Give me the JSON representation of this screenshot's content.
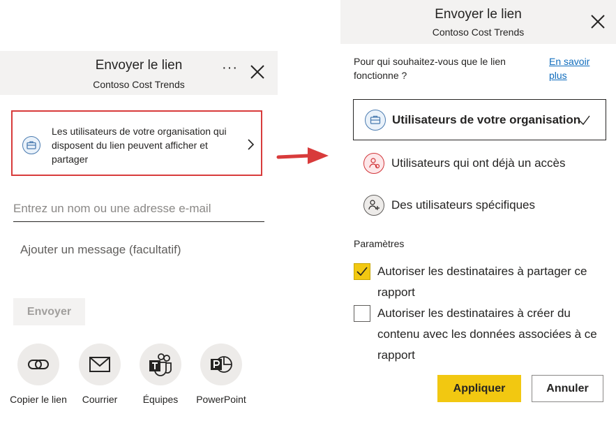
{
  "left_panel": {
    "title": "Envoyer le lien",
    "subtitle": "Contoso Cost Trends",
    "more_label": "···",
    "link_setting_text": "Les utilisateurs de votre organisation qui disposent du lien peuvent afficher et partager",
    "email_placeholder": "Entrez un nom ou une adresse e-mail",
    "message_placeholder": "Ajouter un message (facultatif)",
    "send_label": "Envoyer",
    "share_options": [
      {
        "label": "Copier le lien",
        "icon": "link-icon"
      },
      {
        "label": "Courrier",
        "icon": "mail-icon"
      },
      {
        "label": "Équipes",
        "icon": "teams-icon"
      },
      {
        "label": "PowerPoint",
        "icon": "powerpoint-icon"
      }
    ]
  },
  "right_panel": {
    "title": "Envoyer le lien",
    "subtitle": "Contoso Cost Trends",
    "question": "Pour qui souhaitez-vous que le lien fonctionne ?",
    "learn_more": "En savoir plus",
    "options": [
      {
        "label": "Utilisateurs de votre organisation",
        "selected": true,
        "icon": "briefcase-icon"
      },
      {
        "label": "Utilisateurs qui ont déjà un accès",
        "selected": false,
        "icon": "people-access-icon"
      },
      {
        "label": "Des utilisateurs spécifiques",
        "selected": false,
        "icon": "specific-people-icon"
      }
    ],
    "params_label": "Paramètres",
    "checkboxes": [
      {
        "label": "Autoriser les destinataires à partager ce rapport",
        "checked": true
      },
      {
        "label": "Autoriser les destinataires à créer du contenu avec les données associées à ce rapport",
        "checked": false
      }
    ],
    "apply_label": "Appliquer",
    "cancel_label": "Annuler"
  },
  "colors": {
    "accent_yellow": "#f2c811",
    "highlight_red": "#d83b3b",
    "link_blue": "#0f6cbd",
    "header_gray": "#f3f2f1"
  }
}
